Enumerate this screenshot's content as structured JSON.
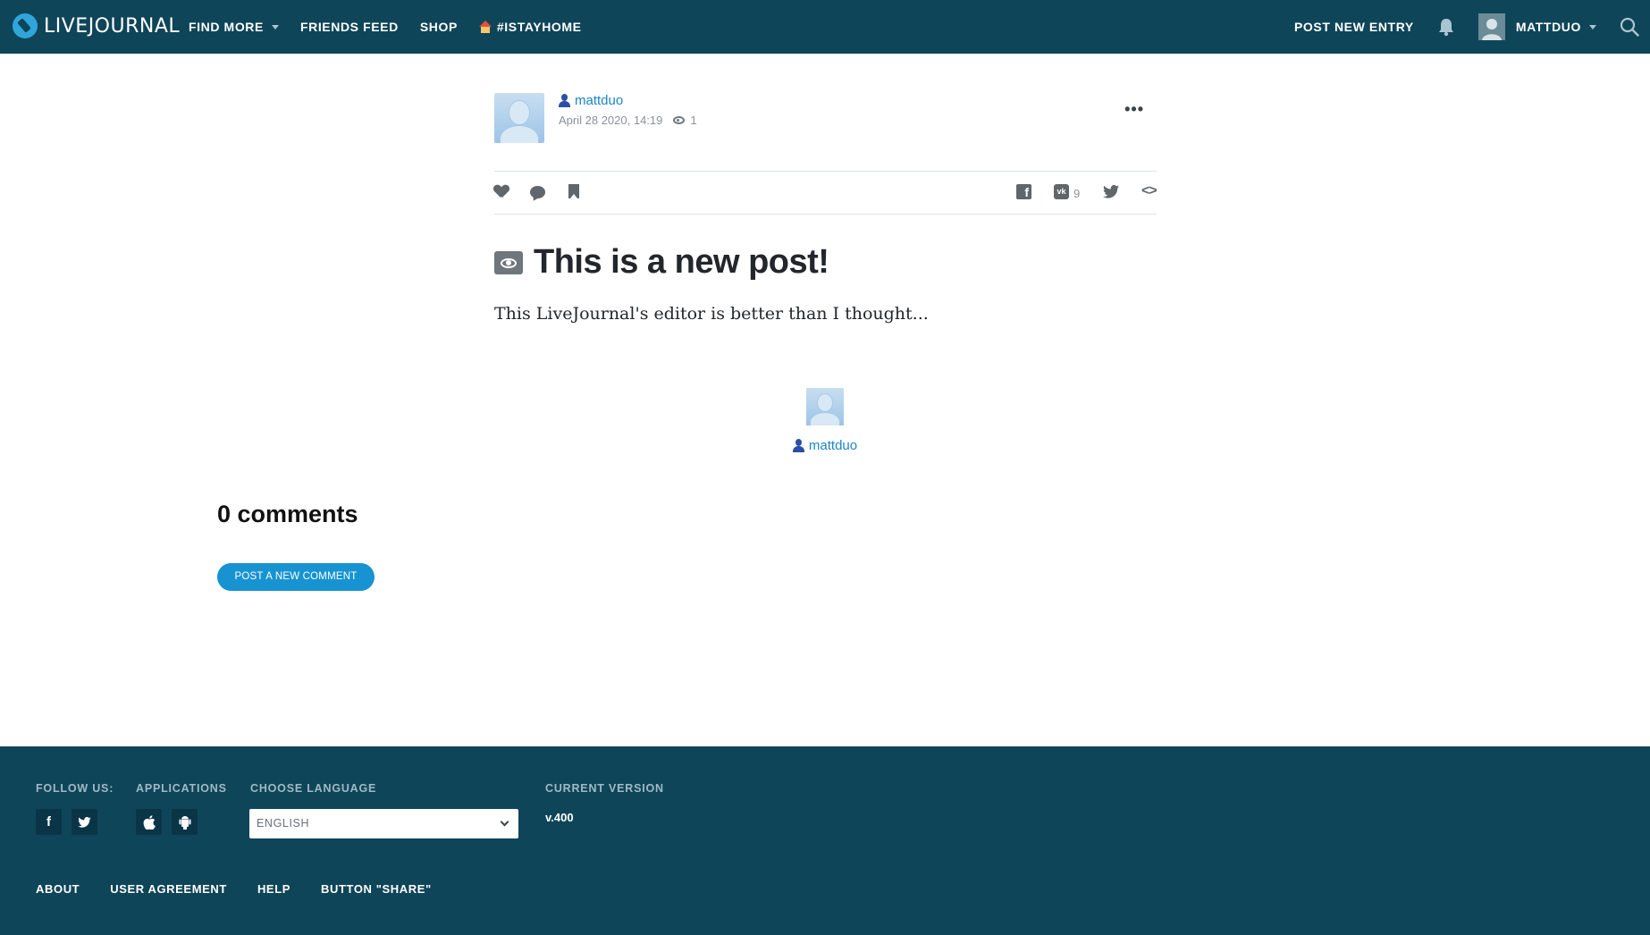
{
  "header": {
    "logo_text": "LIVEJOURNAL",
    "nav": {
      "find_more": "FIND MORE",
      "friends_feed": "FRIENDS FEED",
      "shop": "SHOP",
      "istayhome": "#ISTAYHOME"
    },
    "post_new_entry": "POST NEW ENTRY",
    "username": "MATTDUO"
  },
  "post": {
    "author": "mattduo",
    "date": "April 28 2020, 14:19",
    "views": "1",
    "title": "This is a new post!",
    "body": "This LiveJournal's editor is better than I thought...",
    "share": {
      "vk_count": "9"
    },
    "signature_user": "mattduo"
  },
  "comments": {
    "heading": "0 comments",
    "post_button": "POST A NEW COMMENT"
  },
  "footer": {
    "follow_us": "FOLLOW US:",
    "applications": "APPLICATIONS",
    "choose_language": "CHOOSE LANGUAGE",
    "language_value": "ENGLISH",
    "current_version": "CURRENT VERSION",
    "version": "v.400",
    "links": [
      "ABOUT",
      "USER AGREEMENT",
      "HELP",
      "BUTTON \"SHARE\""
    ]
  },
  "colors": {
    "header_bg": "#0f4559",
    "link": "#1b86c3",
    "button": "#1893d1"
  }
}
